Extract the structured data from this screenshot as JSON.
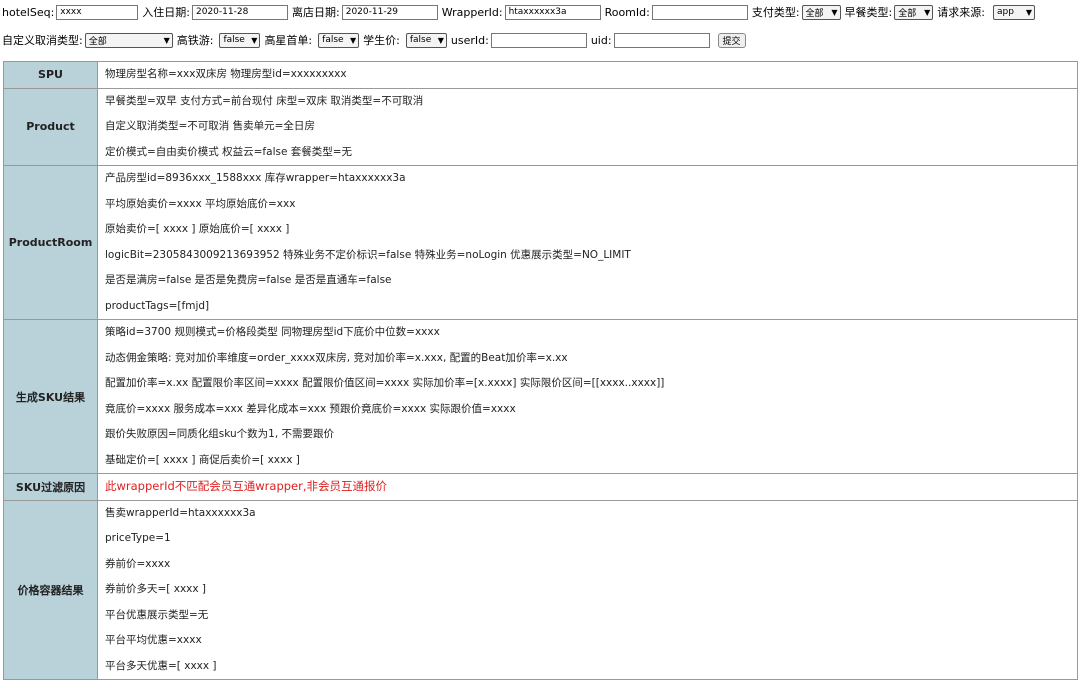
{
  "form": {
    "row1": {
      "hotelSeq_label": "hotelSeq:",
      "hotelSeq_value": "xxxx",
      "checkin_label": "入住日期:",
      "checkin_value": "2020-11-28",
      "checkout_label": "离店日期:",
      "checkout_value": "2020-11-29",
      "wrapperId_label": "WrapperId:",
      "wrapperId_value": "htaxxxxxx3a",
      "roomId_label": "RoomId:",
      "roomId_value": "",
      "payType_label": "支付类型:",
      "payType_value": "全部",
      "breakfast_label": "早餐类型:",
      "breakfast_value": "全部",
      "source_label": "请求来源:",
      "source_value": "app"
    },
    "row2": {
      "cancelType_label": "自定义取消类型:",
      "cancelType_value": "全部",
      "highspeed_label": "高铁游:",
      "highspeed_value": "false",
      "starFirst_label": "高星首单:",
      "starFirst_value": "false",
      "student_label": "学生价:",
      "student_value": "false",
      "userId_label": "userId:",
      "userId_value": "",
      "uid_label": "uid:",
      "uid_value": "",
      "submit_label": "提交"
    }
  },
  "sections": [
    {
      "header": "SPU",
      "lines": [
        "物理房型名称=xxx双床房 物理房型id=xxxxxxxxx"
      ]
    },
    {
      "header": "Product",
      "lines": [
        "早餐类型=双早 支付方式=前台现付 床型=双床 取消类型=不可取消",
        "自定义取消类型=不可取消 售卖单元=全日房",
        "定价模式=自由卖价模式 权益云=false 套餐类型=无"
      ]
    },
    {
      "header": "ProductRoom",
      "lines": [
        "产品房型id=8936xxx_1588xxx 库存wrapper=htaxxxxxx3a",
        "平均原始卖价=xxxx 平均原始底价=xxx",
        "原始卖价=[ xxxx ] 原始底价=[ xxxx ]",
        "logicBit=2305843009213693952 特殊业务不定价标识=false 特殊业务=noLogin 优惠展示类型=NO_LIMIT",
        "是否是满房=false 是否是免费房=false 是否是直通车=false",
        "productTags=[fmjd]"
      ]
    },
    {
      "header": "生成SKU结果",
      "lines": [
        "策略id=3700 规则模式=价格段类型 同物理房型id下底价中位数=xxxx",
        "动态佣金策略: 竞对加价率维度=order_xxxx双床房, 竞对加价率=x.xxx, 配置的Beat加价率=x.xx",
        "配置加价率=x.xx 配置限价率区间=xxxx 配置限价值区间=xxxx 实际加价率=[x.xxxx] 实际限价区间=[[xxxx..xxxx]]",
        "竟底价=xxxx 服务成本=xxx 差异化成本=xxx 预跟价竟底价=xxxx 实际跟价值=xxxx",
        "跟价失败原因=同质化组sku个数为1, 不需要跟价",
        "基础定价=[ xxxx ] 商促后卖价=[ xxxx ]"
      ]
    },
    {
      "header": "SKU过滤原因",
      "red": "此wrapperId不匹配会员互通wrapper,非会员互通报价",
      "lines": []
    },
    {
      "header": "价格容器结果",
      "lines": [
        "售卖wrapperId=htaxxxxxx3a",
        "priceType=1",
        "券前价=xxxx",
        "券前价多天=[ xxxx ]",
        "平台优惠展示类型=无",
        "平台平均优惠=xxxx",
        "平台多天优惠=[ xxxx ]"
      ]
    }
  ],
  "colors": {
    "header_bg": "#b9d1d9",
    "warning_text": "#e02020"
  }
}
